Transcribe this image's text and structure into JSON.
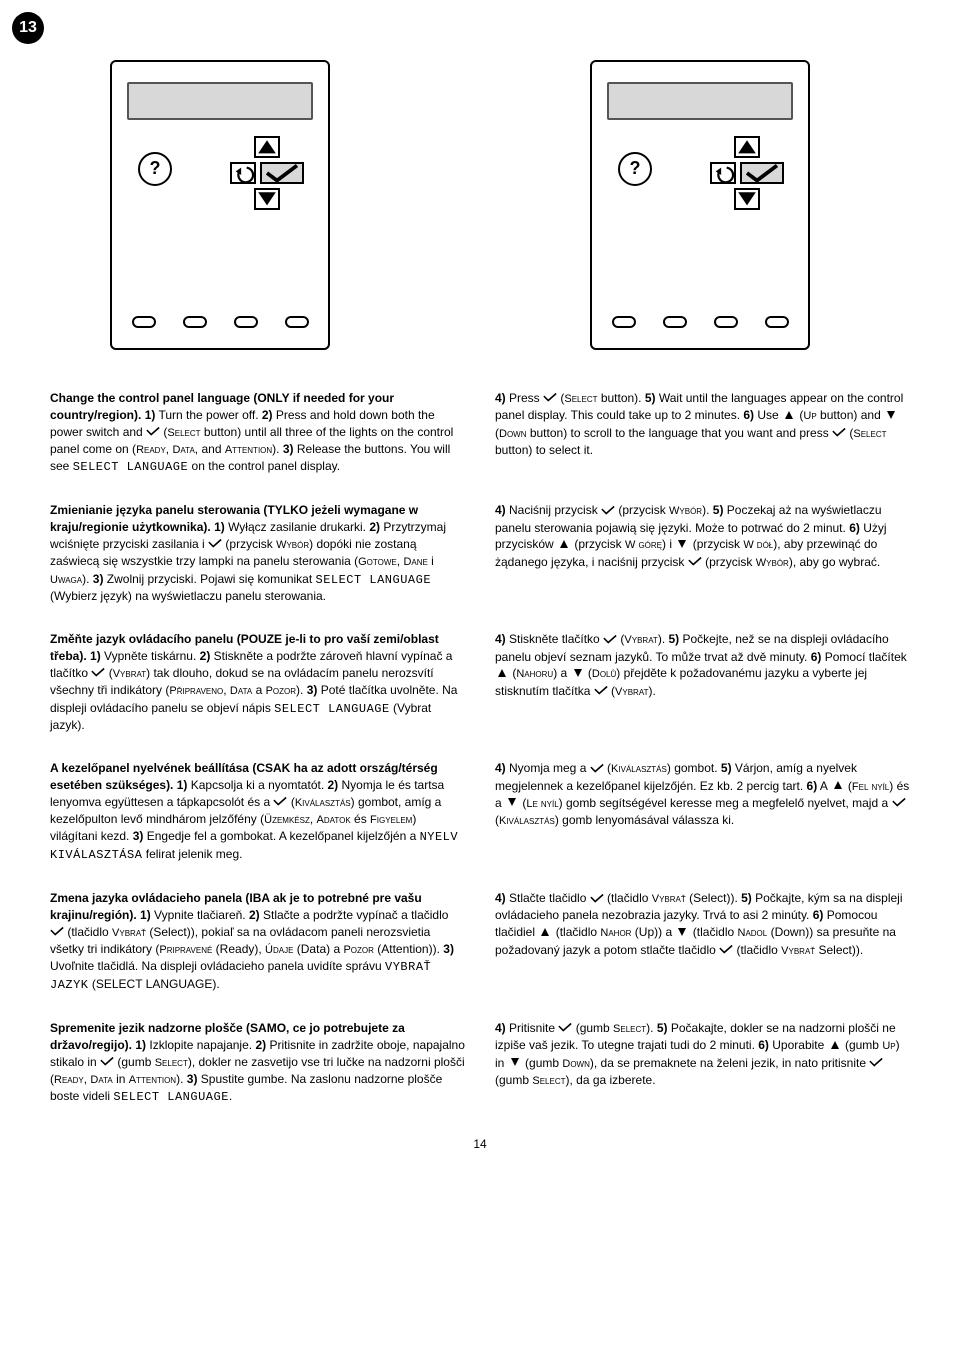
{
  "step_number": "13",
  "page_number": "14",
  "languages": {
    "en": {
      "left": {
        "title": "Change the control panel language (ONLY if needed for your country/region).",
        "s1": "1)",
        "t1": " Turn the power off. ",
        "s2": "2)",
        "t2a": " Press and hold down both the power switch and ",
        "t2b": " (",
        "t2c": "Select",
        "t2d": " button) until all three of the lights on the control panel come on (",
        "t2e": "Ready",
        "t2f": ", ",
        "t2g": "Data",
        "t2h": ", and ",
        "t2i": "Attention",
        "t2j": "). ",
        "s3": "3)",
        "t3a": " Release the buttons. You will see ",
        "t3code": "SELECT LANGUAGE",
        "t3b": " on the control panel display."
      },
      "right": {
        "s4": "4)",
        "t4a": " Press ",
        "t4b": " (",
        "t4c": "Select",
        "t4d": " button). ",
        "s5": "5)",
        "t5": " Wait until the languages appear on the control panel display. This could take up to 2 minutes. ",
        "s6": "6)",
        "t6a": " Use ",
        "t6b": " (",
        "t6c": "Up",
        "t6d": " button) and ",
        "t6e": " (",
        "t6f": "Down",
        "t6g": " button) to scroll to the language that you want and press ",
        "t6h": " (",
        "t6i": "Select",
        "t6j": " button) to select it."
      }
    },
    "pl": {
      "left": {
        "title": "Zmienianie języka panelu sterowania (TYLKO jeżeli wymagane w kraju/regionie użytkownika).",
        "s1": "1)",
        "t1": " Wyłącz zasilanie drukarki. ",
        "s2": "2)",
        "t2a": " Przytrzymaj wciśnięte przyciski zasilania i ",
        "t2b": " (przycisk ",
        "t2c": "Wybór",
        "t2d": ") dopóki nie zostaną zaświecą się wszystkie trzy lampki na panelu sterowania (",
        "t2e": "Gotowe",
        "t2f": ", ",
        "t2g": "Dane",
        "t2h": " i ",
        "t2i": "Uwaga",
        "t2j": "). ",
        "s3": "3)",
        "t3a": " Zwolnij przyciski. Pojawi się komunikat ",
        "t3code": "SELECT LANGUAGE",
        "t3b": " (Wybierz język) na wyświetlaczu panelu sterowania."
      },
      "right": {
        "s4": "4)",
        "t4a": " Naciśnij przycisk ",
        "t4b": " (przycisk ",
        "t4c": "Wybór",
        "t4d": "). ",
        "s5": "5)",
        "t5": " Poczekaj aż na wyświetlaczu panelu sterowania pojawią się języki. Może to potrwać do 2 minut. ",
        "s6": "6)",
        "t6a": " Użyj przycisków ",
        "t6b": " (przycisk ",
        "t6c": "W górę",
        "t6d": ") i ",
        "t6e": " (przycisk ",
        "t6f": "W dół",
        "t6g": "), aby przewinąć do żądanego języka, i naciśnij przycisk ",
        "t6h": " (przycisk ",
        "t6i": "Wybór",
        "t6j": "), aby go wybrać."
      }
    },
    "cs": {
      "left": {
        "title": "Změňte jazyk ovládacího panelu (POUZE je-li to pro vaší zemi/oblast třeba).",
        "s1": "1)",
        "t1": " Vypněte tiskárnu. ",
        "s2": "2)",
        "t2a": " Stiskněte a podržte zároveň hlavní vypínač a tlačítko ",
        "t2b": " (",
        "t2c": "Vybrat",
        "t2d": ") tak dlouho, dokud se na ovládacím panelu nerozsvítí všechny tři indikátory (",
        "t2e": "Připraveno",
        "t2f": ", ",
        "t2g": "Data",
        "t2h": " a ",
        "t2i": "Pozor",
        "t2j": "). ",
        "s3": "3)",
        "t3a": " Poté tlačítka uvolněte. Na displeji ovládacího panelu se objeví nápis ",
        "t3code": "SELECT LANGUAGE",
        "t3b": " (Vybrat jazyk)."
      },
      "right": {
        "s4": "4)",
        "t4a": " Stiskněte tlačítko ",
        "t4b": " (",
        "t4c": "Vybrat",
        "t4d": "). ",
        "s5": "5)",
        "t5": " Počkejte, než se na displeji ovládacího panelu objeví seznam jazyků. To může trvat až dvě minuty. ",
        "s6": "6)",
        "t6a": " Pomocí tlačítek ",
        "t6b": " (",
        "t6c": "Nahoru",
        "t6d": ") a ",
        "t6e": " (",
        "t6f": "Dolů",
        "t6g": ") přejděte k požadovanému jazyku a vyberte jej stisknutím tlačítka ",
        "t6h": " (",
        "t6i": "Vybrat",
        "t6j": ")."
      }
    },
    "hu": {
      "left": {
        "title": "A kezelőpanel nyelvének beállítása (CSAK ha az adott ország/térség esetében szükséges).",
        "s1": "1)",
        "t1": " Kapcsolja ki a nyomtatót. ",
        "s2": "2)",
        "t2a": " Nyomja le és tartsa lenyomva együttesen a tápkapcsolót és a ",
        "t2b": " (",
        "t2c": "Kiválasztás",
        "t2d": ") gombot, amíg a kezelőpulton levő mindhárom jelzőfény (",
        "t2e": "Üzemkész",
        "t2f": ", ",
        "t2g": "Adatok",
        "t2h": " és ",
        "t2i": "Figyelem",
        "t2j": ") világítani kezd. ",
        "s3": "3)",
        "t3a": " Engedje fel a gombokat. A kezelőpanel kijelzőjén a ",
        "t3code": "NYELV KIVÁLASZTÁSA",
        "t3b": " felirat jelenik meg."
      },
      "right": {
        "s4": "4)",
        "t4a": " Nyomja meg a ",
        "t4b": " (",
        "t4c": "Kiválasztás",
        "t4d": ") gombot. ",
        "s5": "5)",
        "t5": " Várjon, amíg a nyelvek megjelennek a kezelőpanel kijelzőjén. Ez kb. 2 percig tart. ",
        "s6": "6)",
        "t6a": " A ",
        "t6b": " (",
        "t6c": "Fel nyíl",
        "t6d": ") és a ",
        "t6e": " (",
        "t6f": "Le nyíl",
        "t6g": ") gomb segítségével keresse meg a megfelelő nyelvet, majd a ",
        "t6h": " (",
        "t6i": "Kiválasztás",
        "t6j": ") gomb lenyomásával válassza ki."
      }
    },
    "sk": {
      "left": {
        "title": "Zmena jazyka ovládacieho panela (IBA ak je to potrebné pre vašu krajinu/región).",
        "s1": "1)",
        "t1": " Vypnite tlačiareň. ",
        "s2": "2)",
        "t2a": " Stlačte a podržte vypínač a tlačidlo ",
        "t2b": " (tlačidlo ",
        "t2c": "Vybrať",
        "t2d": " (Select)), pokiaľ sa na ovládacom paneli nerozsvietia všetky tri indikátory (",
        "t2e": "Pripravené",
        "t2f": " (Ready), ",
        "t2g": "Údaje",
        "t2h": " (Data) a ",
        "t2i": "Pozor",
        "t2j": " (Attention)). ",
        "s3": "3)",
        "t3a": " Uvoľnite tlačidlá. Na displeji ovládacieho panela uvidíte správu ",
        "t3code": "VYBRAŤ JAZYK",
        "t3b": " (SELECT LANGUAGE)."
      },
      "right": {
        "s4": "4)",
        "t4a": " Stlačte tlačidlo ",
        "t4b": " (tlačidlo ",
        "t4c": "Vybrať",
        "t4d": " (Select)). ",
        "s5": "5)",
        "t5": " Počkajte, kým sa na displeji ovládacieho panela nezobrazia jazyky. Trvá to asi 2 minúty. ",
        "s6": "6)",
        "t6a": " Pomocou tlačidiel ",
        "t6b": " (tlačidlo ",
        "t6c": "Nahor",
        "t6d": " (Up)) a ",
        "t6e": " (tlačidlo ",
        "t6f": "Nadol",
        "t6g": " (Down)) sa presuňte na požadovaný jazyk a potom stlačte tlačidlo ",
        "t6h": " (tlačidlo ",
        "t6i": "Vybrať",
        "t6j": " Select))."
      }
    },
    "sl": {
      "left": {
        "title": "Spremenite jezik nadzorne plošče (SAMO, ce jo potrebujete za državo/regijo).",
        "s1": "1)",
        "t1": " Izklopite napajanje. ",
        "s2": "2)",
        "t2a": " Pritisnite in zadržite oboje, napajalno stikalo in ",
        "t2b": " (gumb ",
        "t2c": "Select",
        "t2d": "), dokler ne zasvetijo vse tri lučke na nadzorni plošči (",
        "t2e": "Ready",
        "t2f": ", ",
        "t2g": "Data",
        "t2h": " in ",
        "t2i": "Attention",
        "t2j": "). ",
        "s3": "3)",
        "t3a": " Spustite gumbe. Na zaslonu nadzorne plošče boste videli ",
        "t3code": "SELECT LANGUAGE",
        "t3b": "."
      },
      "right": {
        "s4": "4)",
        "t4a": " Pritisnite ",
        "t4b": " (gumb ",
        "t4c": "Select",
        "t4d": "). ",
        "s5": "5)",
        "t5": " Počakajte, dokler se na nadzorni plošči ne izpiše vaš jezik. To utegne trajati tudi do 2 minuti. ",
        "s6": "6)",
        "t6a": " Uporabite ",
        "t6b": " (gumb ",
        "t6c": "Up",
        "t6d": ") in ",
        "t6e": " (gumb ",
        "t6f": "Down",
        "t6g": "), da se premaknete na želeni jezik, in nato pritisnite ",
        "t6h": " (gumb ",
        "t6i": "Select",
        "t6j": "), da ga izberete."
      }
    }
  }
}
